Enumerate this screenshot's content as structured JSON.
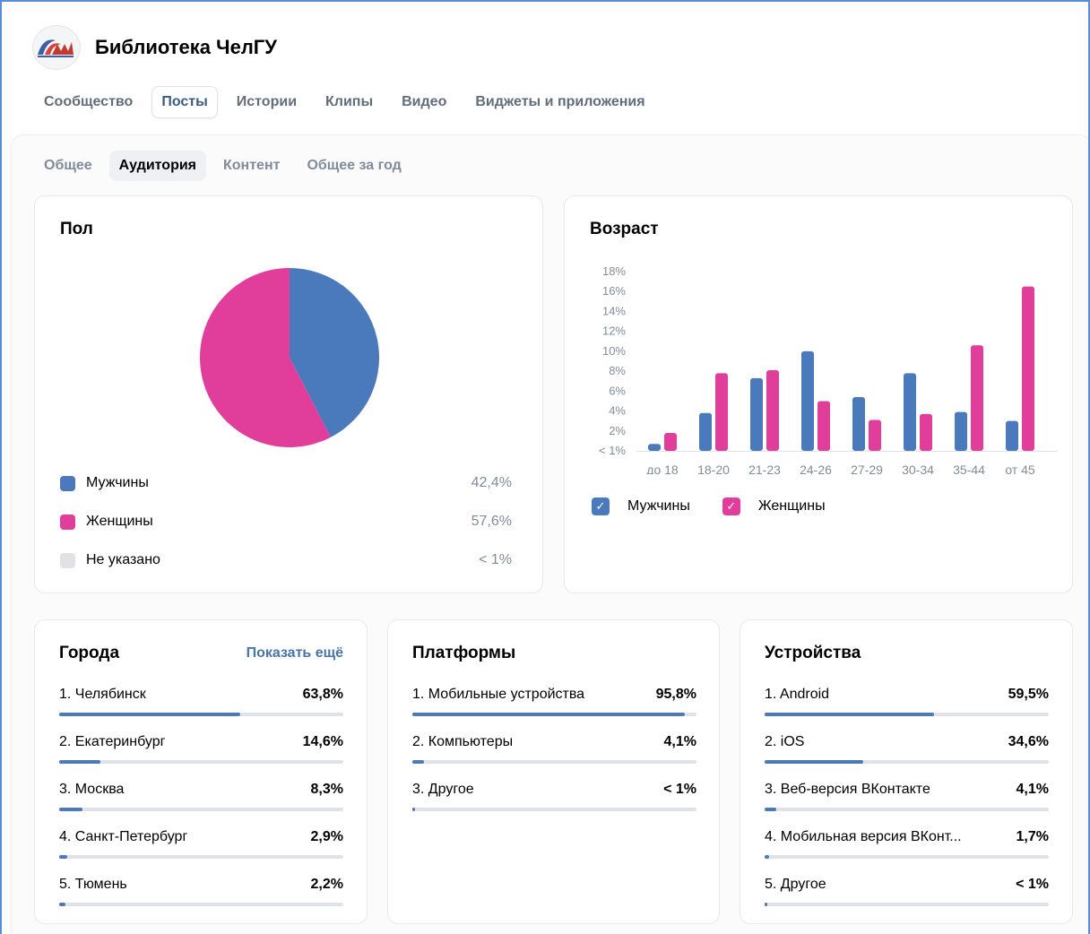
{
  "header": {
    "title": "Библиотека ЧелГУ"
  },
  "main_tabs": [
    {
      "label": "Сообщество",
      "active": false
    },
    {
      "label": "Посты",
      "active": true
    },
    {
      "label": "Истории",
      "active": false
    },
    {
      "label": "Клипы",
      "active": false
    },
    {
      "label": "Видео",
      "active": false
    },
    {
      "label": "Виджеты и приложения",
      "active": false
    }
  ],
  "sub_tabs": [
    {
      "label": "Общее",
      "active": false
    },
    {
      "label": "Аудитория",
      "active": true
    },
    {
      "label": "Контент",
      "active": false
    },
    {
      "label": "Общее за год",
      "active": false
    }
  ],
  "colors": {
    "male": "#4a7abb",
    "female": "#e13e9c",
    "unknown": "#dfe2e6",
    "bar": "#4b7ab7"
  },
  "gender": {
    "title": "Пол",
    "items": [
      {
        "label": "Мужчины",
        "value": "42,4%"
      },
      {
        "label": "Женщины",
        "value": "57,6%"
      },
      {
        "label": "Не указано",
        "value": "< 1%"
      }
    ]
  },
  "age": {
    "title": "Возраст",
    "legend": {
      "male": "Мужчины",
      "female": "Женщины"
    }
  },
  "cities": {
    "title": "Города",
    "show_more": "Показать ещё",
    "items": [
      {
        "name": "1. Челябинск",
        "value": "63,8%",
        "share": 0.638
      },
      {
        "name": "2. Екатеринбург",
        "value": "14,6%",
        "share": 0.146
      },
      {
        "name": "3. Москва",
        "value": "8,3%",
        "share": 0.083
      },
      {
        "name": "4. Санкт-Петербург",
        "value": "2,9%",
        "share": 0.029
      },
      {
        "name": "5. Тюмень",
        "value": "2,2%",
        "share": 0.022
      }
    ]
  },
  "platforms": {
    "title": "Платформы",
    "items": [
      {
        "name": "1. Мобильные устройства",
        "value": "95,8%",
        "share": 0.958
      },
      {
        "name": "2. Компьютеры",
        "value": "4,1%",
        "share": 0.041
      },
      {
        "name": "3. Другое",
        "value": "< 1%",
        "share": 0.009
      }
    ]
  },
  "devices": {
    "title": "Устройства",
    "items": [
      {
        "name": "1. Android",
        "value": "59,5%",
        "share": 0.595
      },
      {
        "name": "2. iOS",
        "value": "34,6%",
        "share": 0.346
      },
      {
        "name": "3. Веб-версия ВКонтакте",
        "value": "4,1%",
        "share": 0.041
      },
      {
        "name": "4. Мобильная версия ВКонт...",
        "value": "1,7%",
        "share": 0.017
      },
      {
        "name": "5. Другое",
        "value": "< 1%",
        "share": 0.009
      }
    ]
  },
  "chart_data": [
    {
      "type": "pie",
      "title": "Пол",
      "categories": [
        "Мужчины",
        "Женщины",
        "Не указано"
      ],
      "values": [
        42.4,
        57.6,
        0
      ]
    },
    {
      "type": "bar",
      "title": "Возраст",
      "categories": [
        "до 18",
        "18-20",
        "21-23",
        "24-26",
        "27-29",
        "30-34",
        "35-44",
        "от 45"
      ],
      "y_tick_labels": [
        "< 1%",
        "2%",
        "4%",
        "6%",
        "8%",
        "10%",
        "12%",
        "14%",
        "16%",
        "18%"
      ],
      "ylim": [
        0,
        18
      ],
      "grid": false,
      "legend_position": "bottom-left",
      "series": [
        {
          "name": "Мужчины",
          "values": [
            0.7,
            3.8,
            7.3,
            10.0,
            5.4,
            7.8,
            3.9,
            3.0
          ]
        },
        {
          "name": "Женщины",
          "values": [
            1.8,
            7.8,
            8.1,
            5.0,
            3.1,
            3.7,
            10.6,
            16.5
          ]
        }
      ]
    }
  ]
}
